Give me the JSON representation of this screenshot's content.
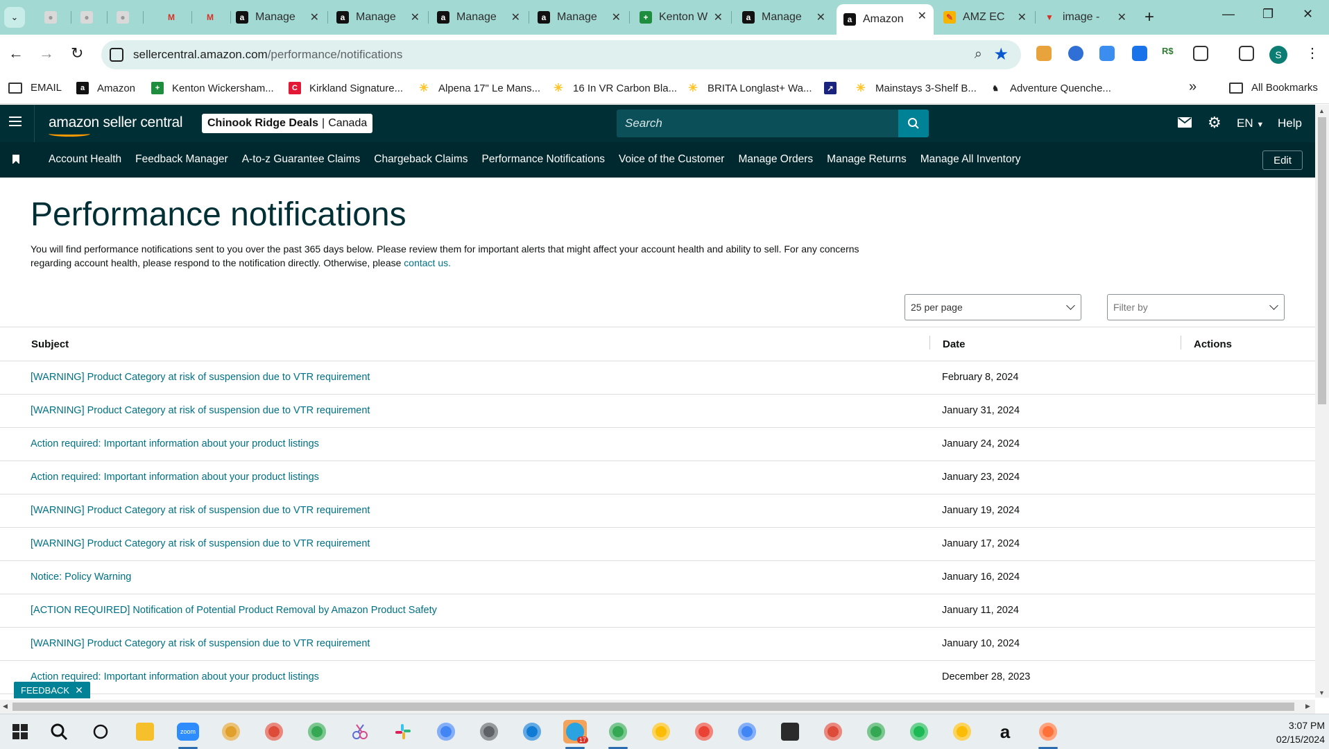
{
  "browser": {
    "tabs": [
      {
        "title": "",
        "favicon": "gray-dot-icon",
        "close": false
      },
      {
        "title": "",
        "favicon": "gray-dot-icon",
        "close": false
      },
      {
        "title": "",
        "favicon": "gray-dot-icon",
        "close": false
      },
      {
        "title": "",
        "favicon": "gmail-icon",
        "close": false
      },
      {
        "title": "",
        "favicon": "gmail-icon",
        "close": false
      },
      {
        "title": "Manage",
        "favicon": "amazon-icon",
        "close": true
      },
      {
        "title": "Manage",
        "favicon": "amazon-icon",
        "close": true
      },
      {
        "title": "Manage",
        "favicon": "amazon-icon",
        "close": true
      },
      {
        "title": "Manage",
        "favicon": "amazon-icon",
        "close": true
      },
      {
        "title": "Kenton W",
        "favicon": "sheets-icon",
        "close": true
      },
      {
        "title": "Manage",
        "favicon": "amazon-icon",
        "close": true
      },
      {
        "title": "Amazon",
        "favicon": "amazon-icon",
        "close": true
      },
      {
        "title": "AMZ EC",
        "favicon": "colorful-icon",
        "close": true
      },
      {
        "title": "image -",
        "favicon": "red-v-icon",
        "close": true
      }
    ],
    "url_host": "sellercentral.amazon.com",
    "url_path": "/performance/notifications",
    "bookmarks": [
      {
        "label": "EMAIL",
        "icon": "folder-icon"
      },
      {
        "label": "Amazon",
        "icon": "amazon-icon"
      },
      {
        "label": "Kenton Wickersham...",
        "icon": "sheets-icon"
      },
      {
        "label": "Kirkland Signature...",
        "icon": "costco-icon"
      },
      {
        "label": "Alpena 17\" Le Mans...",
        "icon": "walmart-icon"
      },
      {
        "label": "16 In VR Carbon Bla...",
        "icon": "walmart-icon"
      },
      {
        "label": "BRITA Longlast+ Wa...",
        "icon": "walmart-icon"
      },
      {
        "label": "",
        "icon": "chart-icon"
      },
      {
        "label": "Mainstays 3-Shelf B...",
        "icon": "walmart-icon"
      },
      {
        "label": "Adventure Quenche...",
        "icon": "cup-icon"
      }
    ],
    "all_bookmarks": "All Bookmarks",
    "more": "»"
  },
  "header": {
    "logo_text": "amazon seller central",
    "store_name": "Chinook Ridge Deals",
    "store_region": "Canada",
    "search_placeholder": "Search",
    "language": "EN",
    "help": "Help"
  },
  "nav": {
    "links": [
      "Account Health",
      "Feedback Manager",
      "A-to-z Guarantee Claims",
      "Chargeback Claims",
      "Performance Notifications",
      "Voice of the Customer",
      "Manage Orders",
      "Manage Returns",
      "Manage All Inventory"
    ],
    "edit": "Edit"
  },
  "page": {
    "title": "Performance notifications",
    "intro": "You will find performance notifications sent to you over the past 365 days below. Please review them for important alerts that might affect your account health and ability to sell. For any concerns regarding account health, please respond to the notification directly. Otherwise, please ",
    "contact_link": "contact us.",
    "per_page": "25 per page",
    "filter_placeholder": "Filter by"
  },
  "table": {
    "headers": {
      "subject": "Subject",
      "date": "Date",
      "actions": "Actions"
    },
    "rows": [
      {
        "subject": "[WARNING] Product Category at risk of suspension due to VTR requirement",
        "date": "February 8, 2024"
      },
      {
        "subject": "[WARNING] Product Category at risk of suspension due to VTR requirement",
        "date": "January 31, 2024"
      },
      {
        "subject": "Action required: Important information about your product listings",
        "date": "January 24, 2024"
      },
      {
        "subject": "Action required: Important information about your product listings",
        "date": "January 23, 2024"
      },
      {
        "subject": "[WARNING] Product Category at risk of suspension due to VTR requirement",
        "date": "January 19, 2024"
      },
      {
        "subject": "[WARNING] Product Category at risk of suspension due to VTR requirement",
        "date": "January 17, 2024"
      },
      {
        "subject": "Notice: Policy Warning",
        "date": "January 16, 2024"
      },
      {
        "subject": "[ACTION REQUIRED] Notification of Potential Product Removal by Amazon Product Safety",
        "date": "January 11, 2024"
      },
      {
        "subject": "[WARNING] Product Category at risk of suspension due to VTR requirement",
        "date": "January 10, 2024"
      },
      {
        "subject": "Action required: Important information about your product listings",
        "date": "December 28, 2023"
      }
    ]
  },
  "feedback": "FEEDBACK",
  "taskbar": {
    "time": "3:07 PM",
    "date": "02/15/2024",
    "telegram_badge": "17",
    "zoom_label": "zoom"
  },
  "colors": {
    "header_bg": "#002f36",
    "nav_bg": "#00292f",
    "link": "#007185",
    "accent": "#008296",
    "tabbar": "#a3d9d3"
  }
}
